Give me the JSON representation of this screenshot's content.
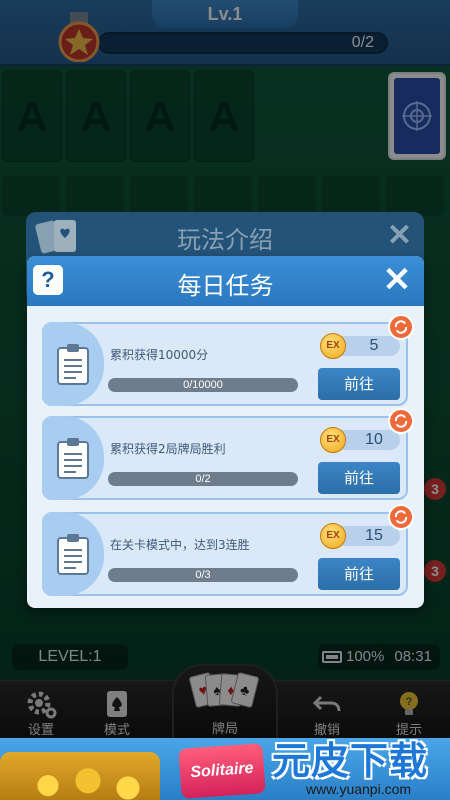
{
  "header": {
    "level_title": "Lv.1",
    "xp_progress": "0/2",
    "xp_fraction": 0
  },
  "foundations": [
    "A",
    "A",
    "A",
    "A"
  ],
  "status": {
    "level_label": "LEVEL:1",
    "battery": "100%",
    "time": "08:31"
  },
  "side_badges": [
    "3",
    "3"
  ],
  "bottom_nav": [
    {
      "label": "设置",
      "icon": "gear-icon"
    },
    {
      "label": "模式",
      "icon": "spade-card-icon"
    },
    {
      "label": "牌局",
      "icon": "card-fan-icon"
    },
    {
      "label": "撤销",
      "icon": "undo-icon"
    },
    {
      "label": "提示",
      "icon": "lightbulb-icon"
    }
  ],
  "back_panel": {
    "title": "玩法介绍"
  },
  "dialog": {
    "title": "每日任务",
    "help": "?",
    "close": "✕",
    "tasks": [
      {
        "desc": "累积获得10000分",
        "progress": "0/10000",
        "reward_badge": "EX",
        "reward": "5",
        "button": "前往"
      },
      {
        "desc": "累积获得2局牌局胜利",
        "progress": "0/2",
        "reward_badge": "EX",
        "reward": "10",
        "button": "前往"
      },
      {
        "desc": "在关卡模式中，达到3连胜",
        "progress": "0/3",
        "reward_badge": "EX",
        "reward": "15",
        "button": "前往"
      }
    ]
  },
  "banner": {
    "logo_text": "Solitaire",
    "watermark_title": "元皮下载",
    "watermark_url": "www.yuanpi.com"
  },
  "colors": {
    "felt": "#0e5a3e",
    "header_blue": "#2f6fa8",
    "dialog_bg": "#e9f1fb",
    "button_blue": "#2b6ea8",
    "refresh_orange": "#ef6a3a"
  }
}
